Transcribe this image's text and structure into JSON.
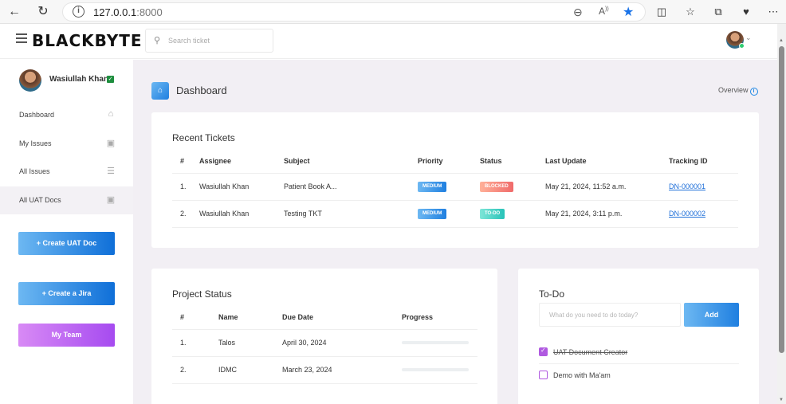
{
  "browser": {
    "url_host": "127.0.0.1",
    "url_port": ":8000",
    "back_icon": "back-arrow-icon",
    "refresh_icon": "refresh-icon",
    "info_icon": "info-icon",
    "info_glyph": "i",
    "zoom_icon": "zoom-icon",
    "read_aloud_icon": "read-aloud-icon",
    "read_aloud_label": "A",
    "favorite_icon": "star-icon",
    "favorite_color": "#1a73e8"
  },
  "header": {
    "brand": "BLACKBYTE",
    "search_placeholder": "Search ticket"
  },
  "sidebar": {
    "user_name": "Wasiullah Khan",
    "items": [
      {
        "label": "Dashboard",
        "icon": "home-icon"
      },
      {
        "label": "My Issues",
        "icon": "contact-card-icon"
      },
      {
        "label": "All Issues",
        "icon": "list-icon"
      },
      {
        "label": "All UAT Docs",
        "icon": "contact-card-icon"
      }
    ],
    "buttons": {
      "create_uat": "+ Create UAT Doc",
      "create_jira": "+ Create a Jira",
      "my_team": "My Team"
    }
  },
  "main": {
    "page_title": "Dashboard",
    "overview_label": "Overview",
    "overview_glyph": "i"
  },
  "recent_tickets": {
    "title": "Recent Tickets",
    "columns": [
      "#",
      "Assignee",
      "Subject",
      "Priority",
      "Status",
      "Last Update",
      "Tracking ID"
    ],
    "rows": [
      {
        "num": "1.",
        "assignee": "Wasiullah Khan",
        "subject": "Patient Book A...",
        "priority": "MEDIUM",
        "status": "BLOCKED",
        "last_update": "May 21, 2024, 11:52 a.m.",
        "tracking_id": "DN-000001"
      },
      {
        "num": "2.",
        "assignee": "Wasiullah Khan",
        "subject": "Testing TKT",
        "priority": "MEDIUM",
        "status": "TO-DO",
        "last_update": "May 21, 2024, 3:11 p.m.",
        "tracking_id": "DN-000002"
      }
    ]
  },
  "project_status": {
    "title": "Project Status",
    "columns": [
      "#",
      "Name",
      "Due Date",
      "Progress"
    ],
    "rows": [
      {
        "num": "1.",
        "name": "Talos",
        "due_date": "April 30, 2024",
        "progress": 0
      },
      {
        "num": "2.",
        "name": "IDMC",
        "due_date": "March 23, 2024",
        "progress": 0
      }
    ]
  },
  "todo": {
    "title": "To-Do",
    "input_placeholder": "What do you need to do today?",
    "add_label": "Add",
    "items": [
      {
        "text": "UAT Document Creator",
        "done": true
      },
      {
        "text": "Demo with Ma'am",
        "done": false
      }
    ]
  },
  "colors": {
    "accent_blue": "#1f7fe0",
    "accent_purple": "#a64bf0",
    "main_bg": "#f2eff4"
  }
}
